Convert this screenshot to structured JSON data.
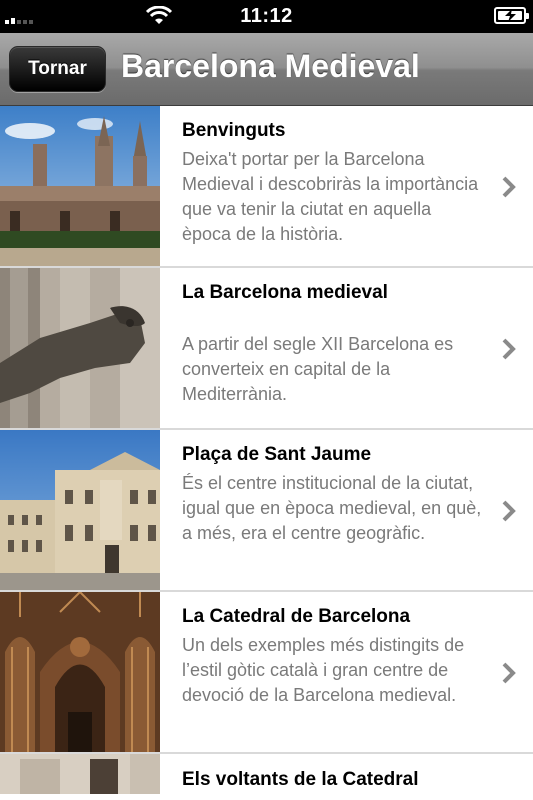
{
  "status_bar": {
    "time": "11:12"
  },
  "nav": {
    "back_label": "Tornar",
    "title": "Barcelona Medieval"
  },
  "items": [
    {
      "title": "Benvinguts",
      "description": "Deixa't portar per la Barcelona Medieval i descobriràs la importància que va tenir la ciutat en aquella època de la història."
    },
    {
      "title": "La Barcelona medieval",
      "description": "A partir del segle XII Barcelona es converteix en capital de la Mediterrània."
    },
    {
      "title": "Plaça de Sant Jaume",
      "description": "És el centre institucional de la ciutat, igual que en època medieval, en què, a més, era el centre geogràfic."
    },
    {
      "title": "La Catedral de Barcelona",
      "description": "Un dels exemples més distingits de l’estil gòtic català i gran centre de devoció de la Barcelona medieval."
    },
    {
      "title": "Els voltants de la Catedral",
      "description": ""
    }
  ],
  "icons": {
    "chevron": "chevron-right-icon",
    "wifi": "wifi-icon",
    "battery": "battery-charging-icon",
    "signal": "signal-icon"
  }
}
